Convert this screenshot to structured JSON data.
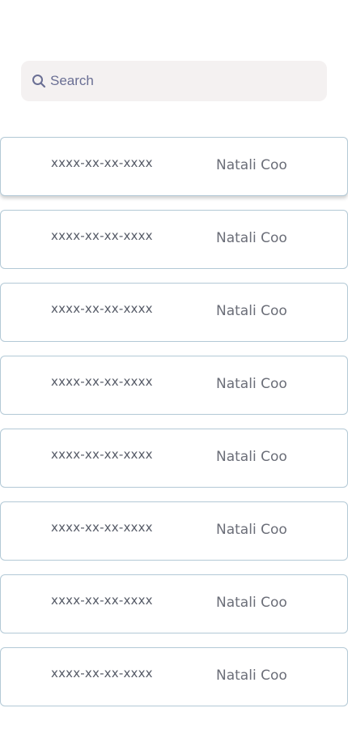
{
  "search": {
    "placeholder": "Search",
    "icon": "search-icon",
    "icon_color": "#6a6f94"
  },
  "colors": {
    "search_background": "#f4f1f1",
    "card_border": "#b3c9d6",
    "code_text": "#555a66",
    "name_text": "#6b6e78"
  },
  "list": {
    "items": [
      {
        "code": "xxxx-xx-xx-xxxx",
        "name": "Natali Coo"
      },
      {
        "code": "xxxx-xx-xx-xxxx",
        "name": "Natali Coo"
      },
      {
        "code": "xxxx-xx-xx-xxxx",
        "name": "Natali Coo"
      },
      {
        "code": "xxxx-xx-xx-xxxx",
        "name": "Natali Coo"
      },
      {
        "code": "xxxx-xx-xx-xxxx",
        "name": "Natali Coo"
      },
      {
        "code": "xxxx-xx-xx-xxxx",
        "name": "Natali Coo"
      },
      {
        "code": "xxxx-xx-xx-xxxx",
        "name": "Natali Coo"
      },
      {
        "code": "xxxx-xx-xx-xxxx",
        "name": "Natali Coo"
      }
    ]
  }
}
